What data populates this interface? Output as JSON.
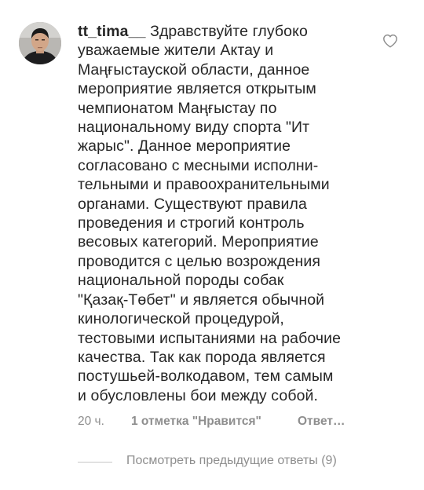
{
  "comment": {
    "username": "tt_tima__",
    "text_lines": [
      "Здравствуйте глубоко",
      "уважаемые жители Актау и",
      "Мaңғыстауской области, данное",
      "мероприятие является открытым",
      "чемпионатом Маңғыстау по",
      "национальному виду спорта \"Ит",
      "жарыс\". Данное мероприятие",
      "согласовано с месными исполни-",
      "тельными и правоохранительными",
      "органами. Существуют правила",
      "проведения и строгий контроль",
      "весовых категорий. Мероприятие",
      "проводится с целью возрождения",
      "национальной породы собак",
      "\"Қазақ-Төбет\" и является обычной",
      "кинологической процедурой,",
      "тестовыми испытаниями на рабочие",
      "качества. Так как порода является",
      "постушьей-волкодавом, тем самым",
      "и обусловлены бои между собой."
    ],
    "time": "20 ч.",
    "likes": "1 отметка \"Нравится\"",
    "reply": "Ответ…"
  },
  "view_replies": "Посмотреть предыдущие ответы (9)",
  "icons": {
    "like": "heart-outline-icon",
    "avatar": "user-avatar-photo"
  },
  "colors": {
    "text": "#262626",
    "secondary": "#8e8e8e"
  }
}
